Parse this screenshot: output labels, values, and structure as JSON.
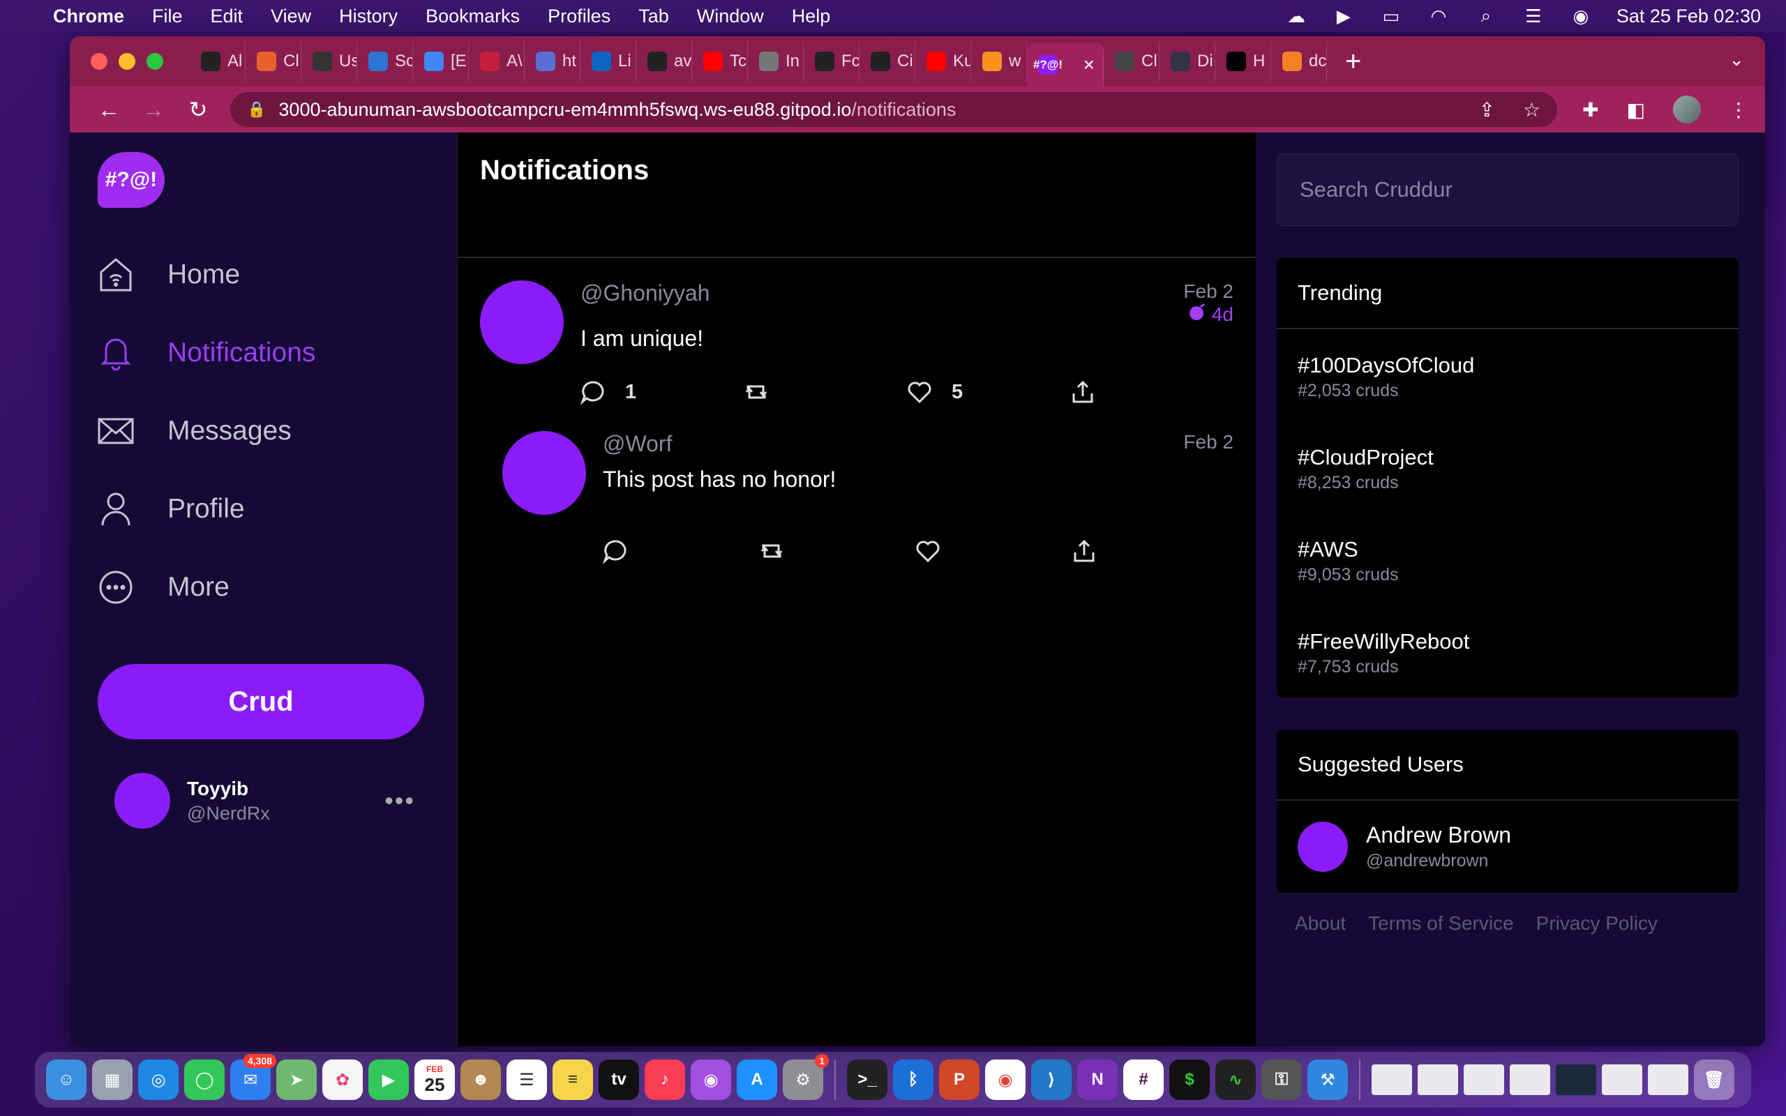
{
  "menubar": {
    "app": "Chrome",
    "items": [
      "File",
      "Edit",
      "View",
      "History",
      "Bookmarks",
      "Profiles",
      "Tab",
      "Window",
      "Help"
    ],
    "datetime": "Sat 25 Feb  02:30"
  },
  "browser": {
    "tabs": [
      {
        "title": "Al",
        "icon": "github-icon",
        "color": "#222"
      },
      {
        "title": "Cl",
        "icon": "cloud-icon",
        "color": "#e8612c"
      },
      {
        "title": "Us",
        "icon": "letter-icon",
        "color": "#333"
      },
      {
        "title": "Sc",
        "icon": "h-icon",
        "color": "#2f74d0"
      },
      {
        "title": "[E",
        "icon": "docs-icon",
        "color": "#4285f4"
      },
      {
        "title": "A\\",
        "icon": "m-icon",
        "color": "#c41e3a"
      },
      {
        "title": "ht",
        "icon": "wing-icon",
        "color": "#5a6fd6"
      },
      {
        "title": "Li",
        "icon": "linkedin-icon",
        "color": "#0a66c2"
      },
      {
        "title": "av",
        "icon": "github-icon",
        "color": "#222"
      },
      {
        "title": "Tc",
        "icon": "youtube-icon",
        "color": "#ff0000"
      },
      {
        "title": "In",
        "icon": "shield-icon",
        "color": "#777"
      },
      {
        "title": "Fc",
        "icon": "github-icon",
        "color": "#222"
      },
      {
        "title": "Ci",
        "icon": "github-icon",
        "color": "#222"
      },
      {
        "title": "Ku",
        "icon": "youtube-icon",
        "color": "#ff0000"
      },
      {
        "title": "w",
        "icon": "g-icon",
        "color": "#f7931e"
      },
      {
        "title": "#?@!",
        "icon": "cruddur-icon",
        "color": "#8c1cf7",
        "active": true
      },
      {
        "title": "Cl",
        "icon": "globe-icon",
        "color": "#444"
      },
      {
        "title": "Di",
        "icon": "circle-icon",
        "color": "#334"
      },
      {
        "title": "H",
        "icon": "medium-icon",
        "color": "#000"
      },
      {
        "title": "dc",
        "icon": "stack-icon",
        "color": "#f48024"
      }
    ],
    "url_host": "3000-abunuman-awsbootcampcru-em4mmh5fswq.ws-eu88.gitpod.io",
    "url_path": "/notifications"
  },
  "app": {
    "logo": "#?@!",
    "nav": [
      {
        "label": "Home",
        "icon": "home-icon"
      },
      {
        "label": "Notifications",
        "icon": "bell-icon",
        "active": true
      },
      {
        "label": "Messages",
        "icon": "envelope-icon"
      },
      {
        "label": "Profile",
        "icon": "person-icon"
      },
      {
        "label": "More",
        "icon": "more-icon"
      }
    ],
    "crud_button": "Crud",
    "user": {
      "name": "Toyyib",
      "handle": "@NerdRx",
      "menu": "•••"
    }
  },
  "main": {
    "title": "Notifications",
    "activities": [
      {
        "handle": "@Ghoniyyah",
        "date": "Feb 2",
        "expires": "4d",
        "message": "I am unique!",
        "replies": "1",
        "likes": "5"
      },
      {
        "handle": "@Worf",
        "date": "Feb 2",
        "message": "This post has no honor!"
      }
    ]
  },
  "sidebar": {
    "search_placeholder": "Search Cruddur",
    "trending_title": "Trending",
    "trending": [
      {
        "tag": "#100DaysOfCloud",
        "count": "#2,053 cruds"
      },
      {
        "tag": "#CloudProject",
        "count": "#8,253 cruds"
      },
      {
        "tag": "#AWS",
        "count": "#9,053 cruds"
      },
      {
        "tag": "#FreeWillyReboot",
        "count": "#7,753 cruds"
      }
    ],
    "suggested_title": "Suggested Users",
    "suggested": [
      {
        "name": "Andrew Brown",
        "handle": "@andrewbrown"
      }
    ],
    "footer": [
      "About",
      "Terms of Service",
      "Privacy Policy"
    ]
  },
  "dock": {
    "mail_badge": "4,308",
    "settings_badge": "1",
    "calendar_month": "FEB",
    "calendar_day": "25"
  },
  "colors": {
    "accent": "#8c1cf7",
    "tab_bar": "#8a1d4e",
    "toolbar": "#a0225c",
    "sidebar_bg": "#140a35"
  }
}
